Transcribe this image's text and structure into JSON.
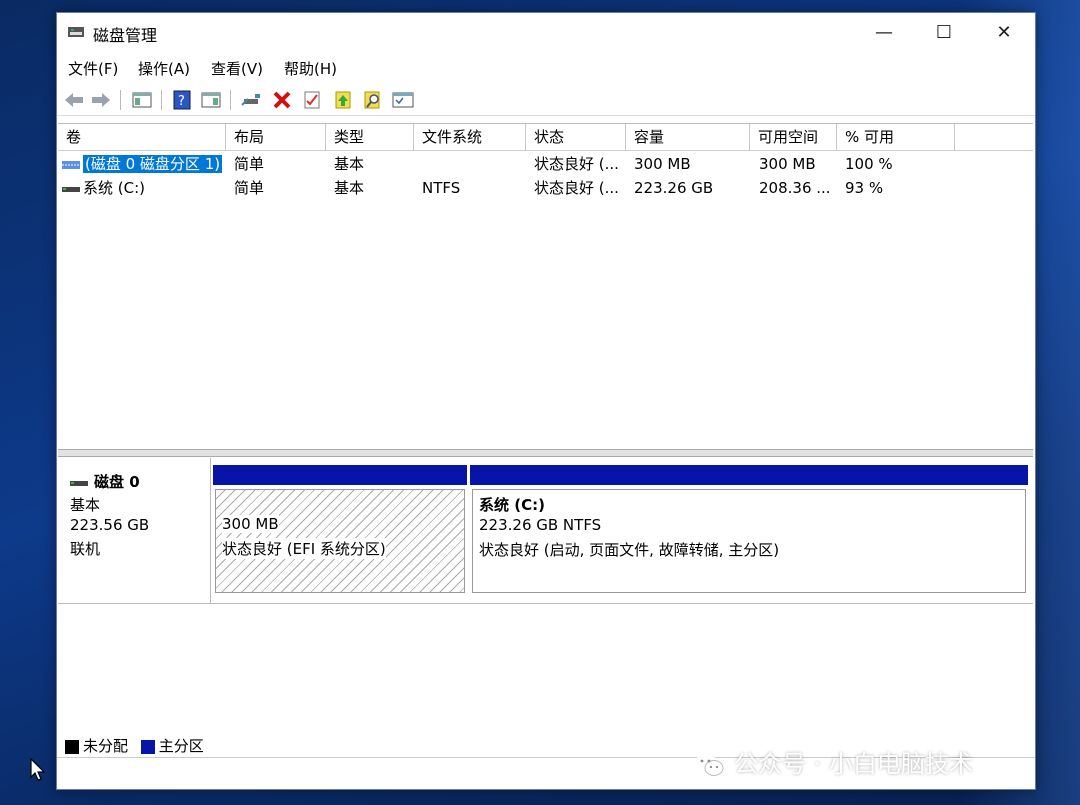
{
  "window": {
    "title": "磁盘管理",
    "minimize": "—",
    "maximize": "☐",
    "close": "✕"
  },
  "menu": [
    "文件(F)",
    "操作(A)",
    "查看(V)",
    "帮助(H)"
  ],
  "toolbar_icons": [
    "back-icon",
    "forward-icon",
    "console-tree-icon",
    "help-icon",
    "view-icon",
    "connect-disk-icon",
    "delete-icon",
    "properties-icon",
    "up-icon",
    "search-icon",
    "list-icon"
  ],
  "table": {
    "headers": [
      "卷",
      "布局",
      "类型",
      "文件系统",
      "状态",
      "容量",
      "可用空间",
      "% 可用"
    ],
    "rows": [
      {
        "volume": "(磁盘 0 磁盘分区 1)",
        "layout": "简单",
        "type": "基本",
        "fs": "",
        "status": "状态良好 (...",
        "capacity": "300 MB",
        "free": "300 MB",
        "pct": "100 %"
      },
      {
        "volume": "系统 (C:)",
        "layout": "简单",
        "type": "基本",
        "fs": "NTFS",
        "status": "状态良好 (...",
        "capacity": "223.26 GB",
        "free": "208.36 ...",
        "pct": "93 %"
      }
    ]
  },
  "disk": {
    "name": "磁盘 0",
    "type": "基本",
    "size": "223.56 GB",
    "state": "联机",
    "partitions": [
      {
        "title": "",
        "size": "300 MB",
        "status": "状态良好 (EFI 系统分区)"
      },
      {
        "title": "系统  (C:)",
        "size": "223.26 GB NTFS",
        "status": "状态良好 (启动, 页面文件, 故障转储, 主分区)"
      }
    ]
  },
  "legend": [
    {
      "label": "未分配",
      "color": "#000000"
    },
    {
      "label": "主分区",
      "color": "#0714a8"
    }
  ],
  "watermark": "公众号 · 小白电脑技术",
  "colors": {
    "primary_partition": "#0714a8",
    "selection": "#0078d7"
  }
}
